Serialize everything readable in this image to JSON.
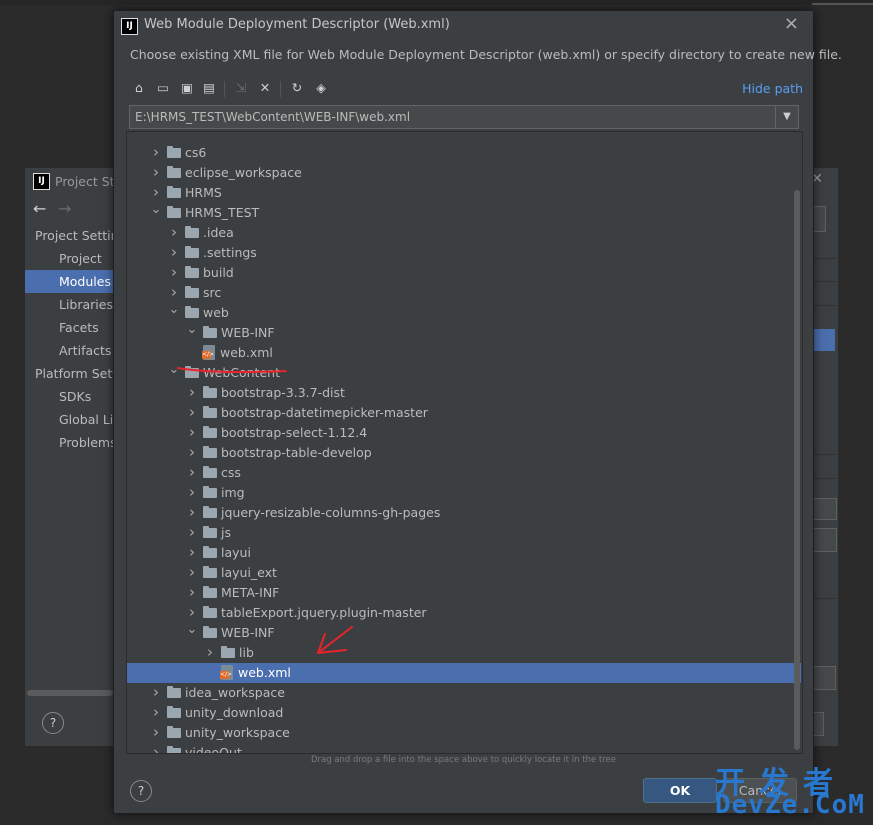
{
  "background_window": {
    "title": "Project Structure",
    "sidebar": [
      {
        "label": "Project Settings",
        "type": "header",
        "selected": false
      },
      {
        "label": "Project",
        "type": "item",
        "selected": false
      },
      {
        "label": "Modules",
        "type": "item",
        "selected": true
      },
      {
        "label": "Libraries",
        "type": "item",
        "selected": false
      },
      {
        "label": "Facets",
        "type": "item",
        "selected": false
      },
      {
        "label": "Artifacts",
        "type": "item",
        "selected": false
      },
      {
        "label": "Platform Settings",
        "type": "header",
        "selected": false
      },
      {
        "label": "SDKs",
        "type": "item",
        "selected": false
      },
      {
        "label": "Global Libraries",
        "type": "item",
        "selected": false
      },
      {
        "label": "Problems",
        "type": "item",
        "selected": false
      }
    ],
    "help_label": "?",
    "back_icon": "arrow-left-icon",
    "forward_icon": "arrow-right-icon"
  },
  "dialog": {
    "title": "Web Module Deployment Descriptor (Web.xml)",
    "description": "Choose existing XML file for Web Module Deployment Descriptor (web.xml) or specify directory to create new file.",
    "hide_path_label": "Hide path",
    "path_value": "E:\\HRMS_TEST\\WebContent\\WEB-INF\\web.xml",
    "toolbar": [
      {
        "icon": "home-icon",
        "glyph": "⌂",
        "enabled": true
      },
      {
        "icon": "desktop-icon",
        "glyph": "▭",
        "enabled": true
      },
      {
        "icon": "new-folder-icon",
        "glyph": "▣",
        "enabled": true
      },
      {
        "icon": "project-folder-icon",
        "glyph": "▤",
        "enabled": true
      },
      {
        "icon": "collapse-icon",
        "glyph": "⇲",
        "enabled": false
      },
      {
        "icon": "delete-icon",
        "glyph": "✕",
        "enabled": true
      },
      {
        "icon": "refresh-icon",
        "glyph": "↻",
        "enabled": true
      },
      {
        "icon": "show-hidden-icon",
        "glyph": "◈",
        "enabled": true
      }
    ],
    "tree": [
      {
        "label": "cs6",
        "depth": 0,
        "type": "folder",
        "expanded": false
      },
      {
        "label": "eclipse_workspace",
        "depth": 0,
        "type": "folder",
        "expanded": false
      },
      {
        "label": "HRMS",
        "depth": 0,
        "type": "folder",
        "expanded": false
      },
      {
        "label": "HRMS_TEST",
        "depth": 0,
        "type": "folder",
        "expanded": true
      },
      {
        "label": ".idea",
        "depth": 1,
        "type": "folder",
        "expanded": false
      },
      {
        "label": ".settings",
        "depth": 1,
        "type": "folder",
        "expanded": false
      },
      {
        "label": "build",
        "depth": 1,
        "type": "folder",
        "expanded": false
      },
      {
        "label": "src",
        "depth": 1,
        "type": "folder",
        "expanded": false
      },
      {
        "label": "web",
        "depth": 1,
        "type": "folder",
        "expanded": true
      },
      {
        "label": "WEB-INF",
        "depth": 2,
        "type": "folder",
        "expanded": true
      },
      {
        "label": "web.xml",
        "depth": 3,
        "type": "xml"
      },
      {
        "label": "WebContent",
        "depth": 1,
        "type": "folder",
        "expanded": true
      },
      {
        "label": "bootstrap-3.3.7-dist",
        "depth": 2,
        "type": "folder",
        "expanded": false
      },
      {
        "label": "bootstrap-datetimepicker-master",
        "depth": 2,
        "type": "folder",
        "expanded": false
      },
      {
        "label": "bootstrap-select-1.12.4",
        "depth": 2,
        "type": "folder",
        "expanded": false
      },
      {
        "label": "bootstrap-table-develop",
        "depth": 2,
        "type": "folder",
        "expanded": false
      },
      {
        "label": "css",
        "depth": 2,
        "type": "folder",
        "expanded": false
      },
      {
        "label": "img",
        "depth": 2,
        "type": "folder",
        "expanded": false
      },
      {
        "label": "jquery-resizable-columns-gh-pages",
        "depth": 2,
        "type": "folder",
        "expanded": false
      },
      {
        "label": "js",
        "depth": 2,
        "type": "folder",
        "expanded": false
      },
      {
        "label": "layui",
        "depth": 2,
        "type": "folder",
        "expanded": false
      },
      {
        "label": "layui_ext",
        "depth": 2,
        "type": "folder",
        "expanded": false
      },
      {
        "label": "META-INF",
        "depth": 2,
        "type": "folder",
        "expanded": false
      },
      {
        "label": "tableExport.jquery.plugin-master",
        "depth": 2,
        "type": "folder",
        "expanded": false
      },
      {
        "label": "WEB-INF",
        "depth": 2,
        "type": "folder",
        "expanded": true
      },
      {
        "label": "lib",
        "depth": 3,
        "type": "folder",
        "expanded": false
      },
      {
        "label": "web.xml",
        "depth": 4,
        "type": "xml",
        "selected": true
      },
      {
        "label": "idea_workspace",
        "depth": 0,
        "type": "folder",
        "expanded": false
      },
      {
        "label": "unity_download",
        "depth": 0,
        "type": "folder",
        "expanded": false
      },
      {
        "label": "unity_workspace",
        "depth": 0,
        "type": "folder",
        "expanded": false
      },
      {
        "label": "videoOut",
        "depth": 0,
        "type": "folder",
        "expanded": false
      }
    ],
    "hint": "Drag and drop a file into the space above to quickly locate it in the tree",
    "ok_label": "OK",
    "cancel_label": "Cancel",
    "help_label": "?"
  },
  "watermark": {
    "cn": "开发者",
    "en": "DevZe.CoM"
  },
  "colors": {
    "selection": "#4b6eaf",
    "link": "#589df6",
    "annotation": "#e8232a",
    "ok_button": "#365880",
    "watermark": "#2878d0"
  }
}
